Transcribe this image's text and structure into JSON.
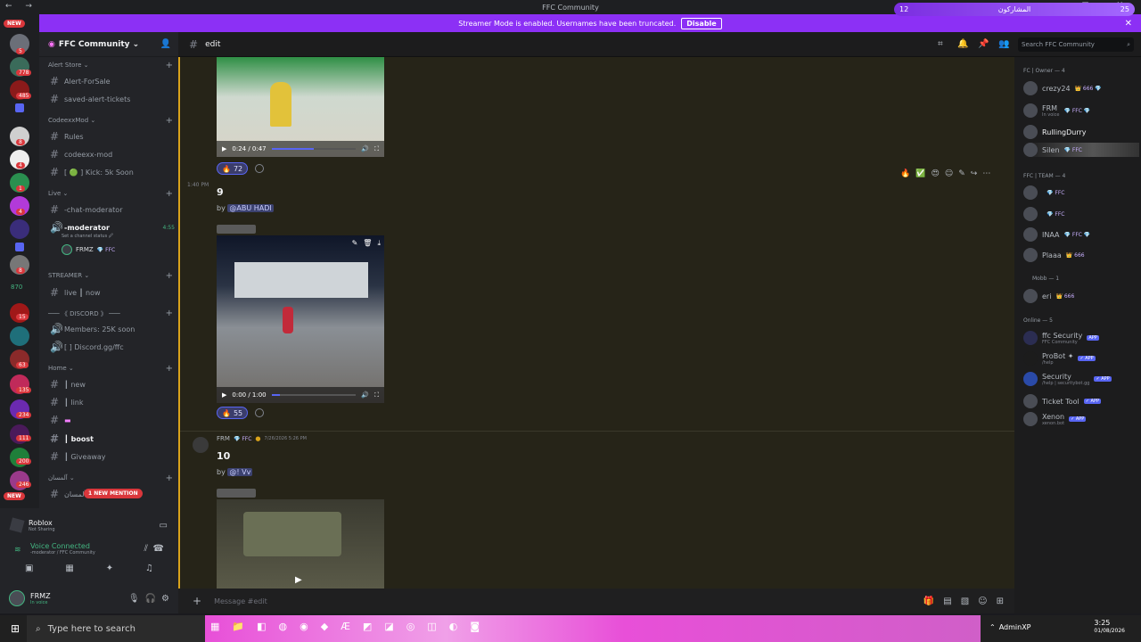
{
  "window": {
    "title": "FFC Community",
    "nav": "← →",
    "controls": "— ▢ ✕"
  },
  "top_pill": {
    "left": "12",
    "center": "المشاركون",
    "right": "25"
  },
  "streamer": {
    "message": "Streamer Mode is enabled. Usernames have been truncated.",
    "button": "Disable"
  },
  "rail": {
    "new_top": "NEW",
    "new_bottom": "NEW",
    "badges": [
      "5",
      "778",
      "485",
      "8",
      "4",
      "1",
      "4",
      "8",
      "1",
      "870",
      "15",
      "63",
      "135",
      "234",
      "111",
      "200",
      "246"
    ]
  },
  "server": {
    "name": "FFC Community ⌄"
  },
  "sidebar": {
    "categories": [
      "Alert Store ⌄",
      "CodeexxMod ⌄",
      "Live ⌄",
      "STREAMER ⌄",
      "─── 《 DISCORD 》 ───",
      "Home ⌄",
      "آلمسان ⌄"
    ],
    "channels": [
      "Alert-ForSale",
      "saved-alert-tickets",
      "Rules",
      "codeexx-mod",
      "[ 🟢 ] Kick: 5k Soon",
      "-chat-moderator",
      "-moderator",
      "live ┃ now",
      "Members: 25K soon",
      "[ ] Discord.gg/ffc",
      "┃ new",
      "┃ link",
      "",
      "┃ boost",
      "┃ Giveaway",
      "آلمسان"
    ],
    "voice_time": "4:55",
    "status_hint": "Set a channel status 🖉",
    "voice_user": "FRMZ",
    "voice_user_tag": "💎 FFC",
    "new_mention": "1 NEW MENTION"
  },
  "activity": {
    "title": "Roblox",
    "subtitle": "Not Sharing"
  },
  "voice": {
    "status": "Voice Connected",
    "channel": "-moderator / FFC Community"
  },
  "user": {
    "name": "FRMZ",
    "status": "In voice"
  },
  "chat_header": {
    "channel": "edit",
    "search_placeholder": "Search FFC Community"
  },
  "messages": [
    {
      "video_time": "0:24 / 0:47",
      "reaction_count": "72",
      "progress": 0.5
    },
    {
      "time": "1:40 PM",
      "number": "9",
      "by": "by",
      "mention": "@ABU HADI",
      "video_time": "0:00 / 1:00",
      "reaction_count": "55",
      "progress": 0.1
    },
    {
      "author": "FRM",
      "author_tag": "💎 FFC",
      "timestamp": "7/26/2026 5:26 PM",
      "number": "10",
      "by": "by",
      "mention": "@! Vv"
    }
  ],
  "members": {
    "groups": [
      "FC | Owner — 4",
      "FFC | TEAM — 4",
      "Mobb — 1",
      "Online — 5"
    ],
    "list": [
      {
        "name": "crezy24",
        "tag": "👑 666 💎",
        "sub": ""
      },
      {
        "name": "FRM",
        "tag": "💎 FFC 💎",
        "sub": "In voice"
      },
      {
        "name": "RullingDurry",
        "tag": "",
        "sub": ""
      },
      {
        "name": "Silen",
        "tag": "💎 FFC",
        "sub": ""
      },
      {
        "name": "",
        "tag": "💎 FFC",
        "sub": ""
      },
      {
        "name": "",
        "tag": "💎 FFC",
        "sub": ""
      },
      {
        "name": "INAA",
        "tag": "💎 FFC 💎",
        "sub": ""
      },
      {
        "name": "Plaaa",
        "tag": "👑 666",
        "sub": ""
      },
      {
        "name": "eri",
        "tag": "👑 666",
        "sub": ""
      },
      {
        "name": "ffc Security",
        "tag": "APP",
        "sub": "FFC Community"
      },
      {
        "name": "ProBot ✦",
        "tag": "✓ APP",
        "sub": "/help"
      },
      {
        "name": "Security",
        "tag": "✓ APP",
        "sub": "/help | securitybot.gg"
      },
      {
        "name": "Ticket Tool",
        "tag": "✓ APP",
        "sub": ""
      },
      {
        "name": "Xenon",
        "tag": "✓ APP",
        "sub": "xenon.bot"
      }
    ]
  },
  "composer": {
    "placeholder": "Message #edit"
  },
  "taskbar": {
    "search": "Type here to search",
    "user": "AdminXP",
    "clock": "3:25",
    "date": "01/08/2026"
  }
}
